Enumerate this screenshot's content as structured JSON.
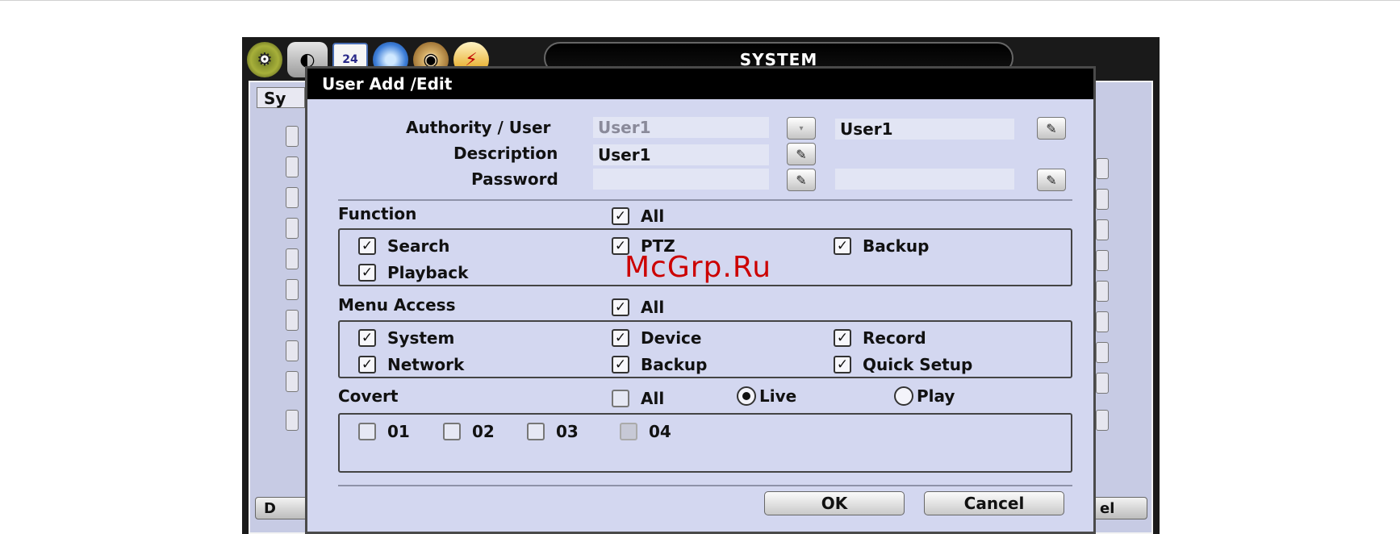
{
  "window": {
    "title": "SYSTEM",
    "tab_stub": "Sy"
  },
  "background": {
    "bottom_left_button": "D",
    "bottom_right_button": "el"
  },
  "toolbar_icons": [
    "gear-icon",
    "camera-icon",
    "calendar-icon",
    "network-globe-icon",
    "disk-icon",
    "flash-icon"
  ],
  "toolbar_calendar_text": "24",
  "dialog": {
    "title": "User Add /Edit",
    "fields": {
      "authority_label": "Authority / User",
      "authority_value": "User1",
      "user_value": "User1",
      "description_label": "Description",
      "description_value": "User1",
      "password_label": "Password",
      "password_value": "",
      "password_confirm_value": ""
    },
    "function": {
      "label": "Function",
      "all": {
        "label": "All",
        "checked": true
      },
      "items": [
        {
          "label": "Search",
          "checked": true
        },
        {
          "label": "PTZ",
          "checked": true
        },
        {
          "label": "Backup",
          "checked": true
        },
        {
          "label": "Playback",
          "checked": true
        }
      ]
    },
    "menu_access": {
      "label": "Menu Access",
      "all": {
        "label": "All",
        "checked": true
      },
      "items": [
        {
          "label": "System",
          "checked": true
        },
        {
          "label": "Device",
          "checked": true
        },
        {
          "label": "Record",
          "checked": true
        },
        {
          "label": "Network",
          "checked": true
        },
        {
          "label": "Backup",
          "checked": true
        },
        {
          "label": "Quick Setup",
          "checked": true
        }
      ]
    },
    "covert": {
      "label": "Covert",
      "all": {
        "label": "All",
        "checked": false
      },
      "modes": [
        {
          "label": "Live",
          "selected": true
        },
        {
          "label": "Play",
          "selected": false
        }
      ],
      "channels": [
        {
          "label": "01",
          "checked": false
        },
        {
          "label": "02",
          "checked": false
        },
        {
          "label": "03",
          "checked": false
        },
        {
          "label": "04",
          "checked": false
        }
      ]
    },
    "buttons": {
      "ok": "OK",
      "cancel": "Cancel"
    }
  },
  "watermark": "McGrp.Ru",
  "colors": {
    "dialog_bg": "#d3d7f0",
    "title_bar": "#000000",
    "watermark": "#cc0000"
  }
}
